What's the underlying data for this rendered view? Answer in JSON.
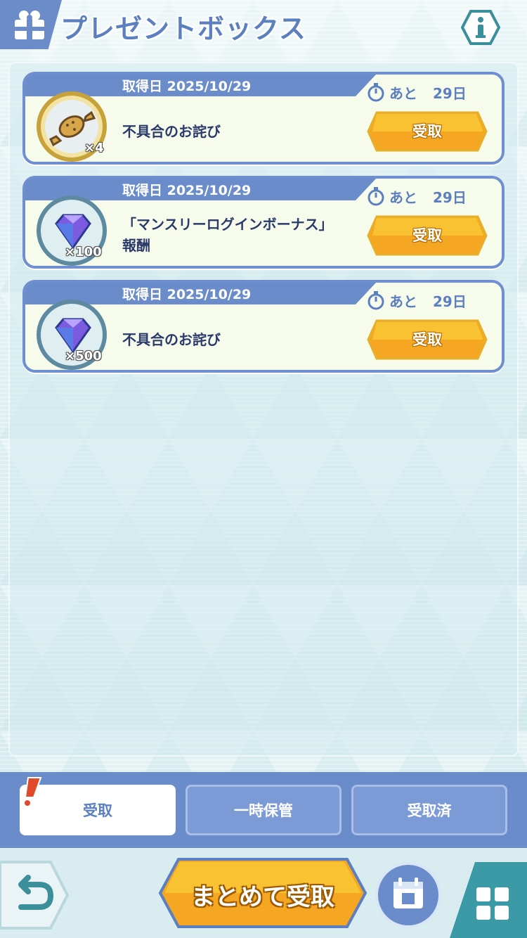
{
  "header": {
    "title": "プレゼントボックス",
    "info_icon": "info-icon",
    "gift_icon": "gift-icon"
  },
  "presents": [
    {
      "date_label": "取得日 2025/10/29",
      "remaining_prefix": "あと",
      "remaining_days": "29日",
      "item_icon": "candy-icon",
      "quantity": "×4",
      "name_line1": "不具合のお詫び",
      "name_line2": "",
      "button_label": "受取"
    },
    {
      "date_label": "取得日 2025/10/29",
      "remaining_prefix": "あと",
      "remaining_days": "29日",
      "item_icon": "gem-icon",
      "quantity": "×100",
      "name_line1": "「マンスリーログインボーナス」",
      "name_line2": "報酬",
      "button_label": "受取"
    },
    {
      "date_label": "取得日 2025/10/29",
      "remaining_prefix": "あと",
      "remaining_days": "29日",
      "item_icon": "gem-icon",
      "quantity": "×500",
      "name_line1": "不具合のお詫び",
      "name_line2": "",
      "button_label": "受取"
    }
  ],
  "tabs": [
    {
      "label": "受取",
      "active": true
    },
    {
      "label": "一時保管",
      "active": false
    },
    {
      "label": "受取済",
      "active": false
    }
  ],
  "footer": {
    "back_icon": "back-arrow-icon",
    "bulk_receive_label": "まとめて受取",
    "calendar_icon": "calendar-icon",
    "menu_icon": "grid-menu-icon"
  },
  "colors": {
    "accent_blue": "#6b8ccb",
    "button_orange": "#f5a623",
    "card_bg": "#f7fbeb"
  }
}
